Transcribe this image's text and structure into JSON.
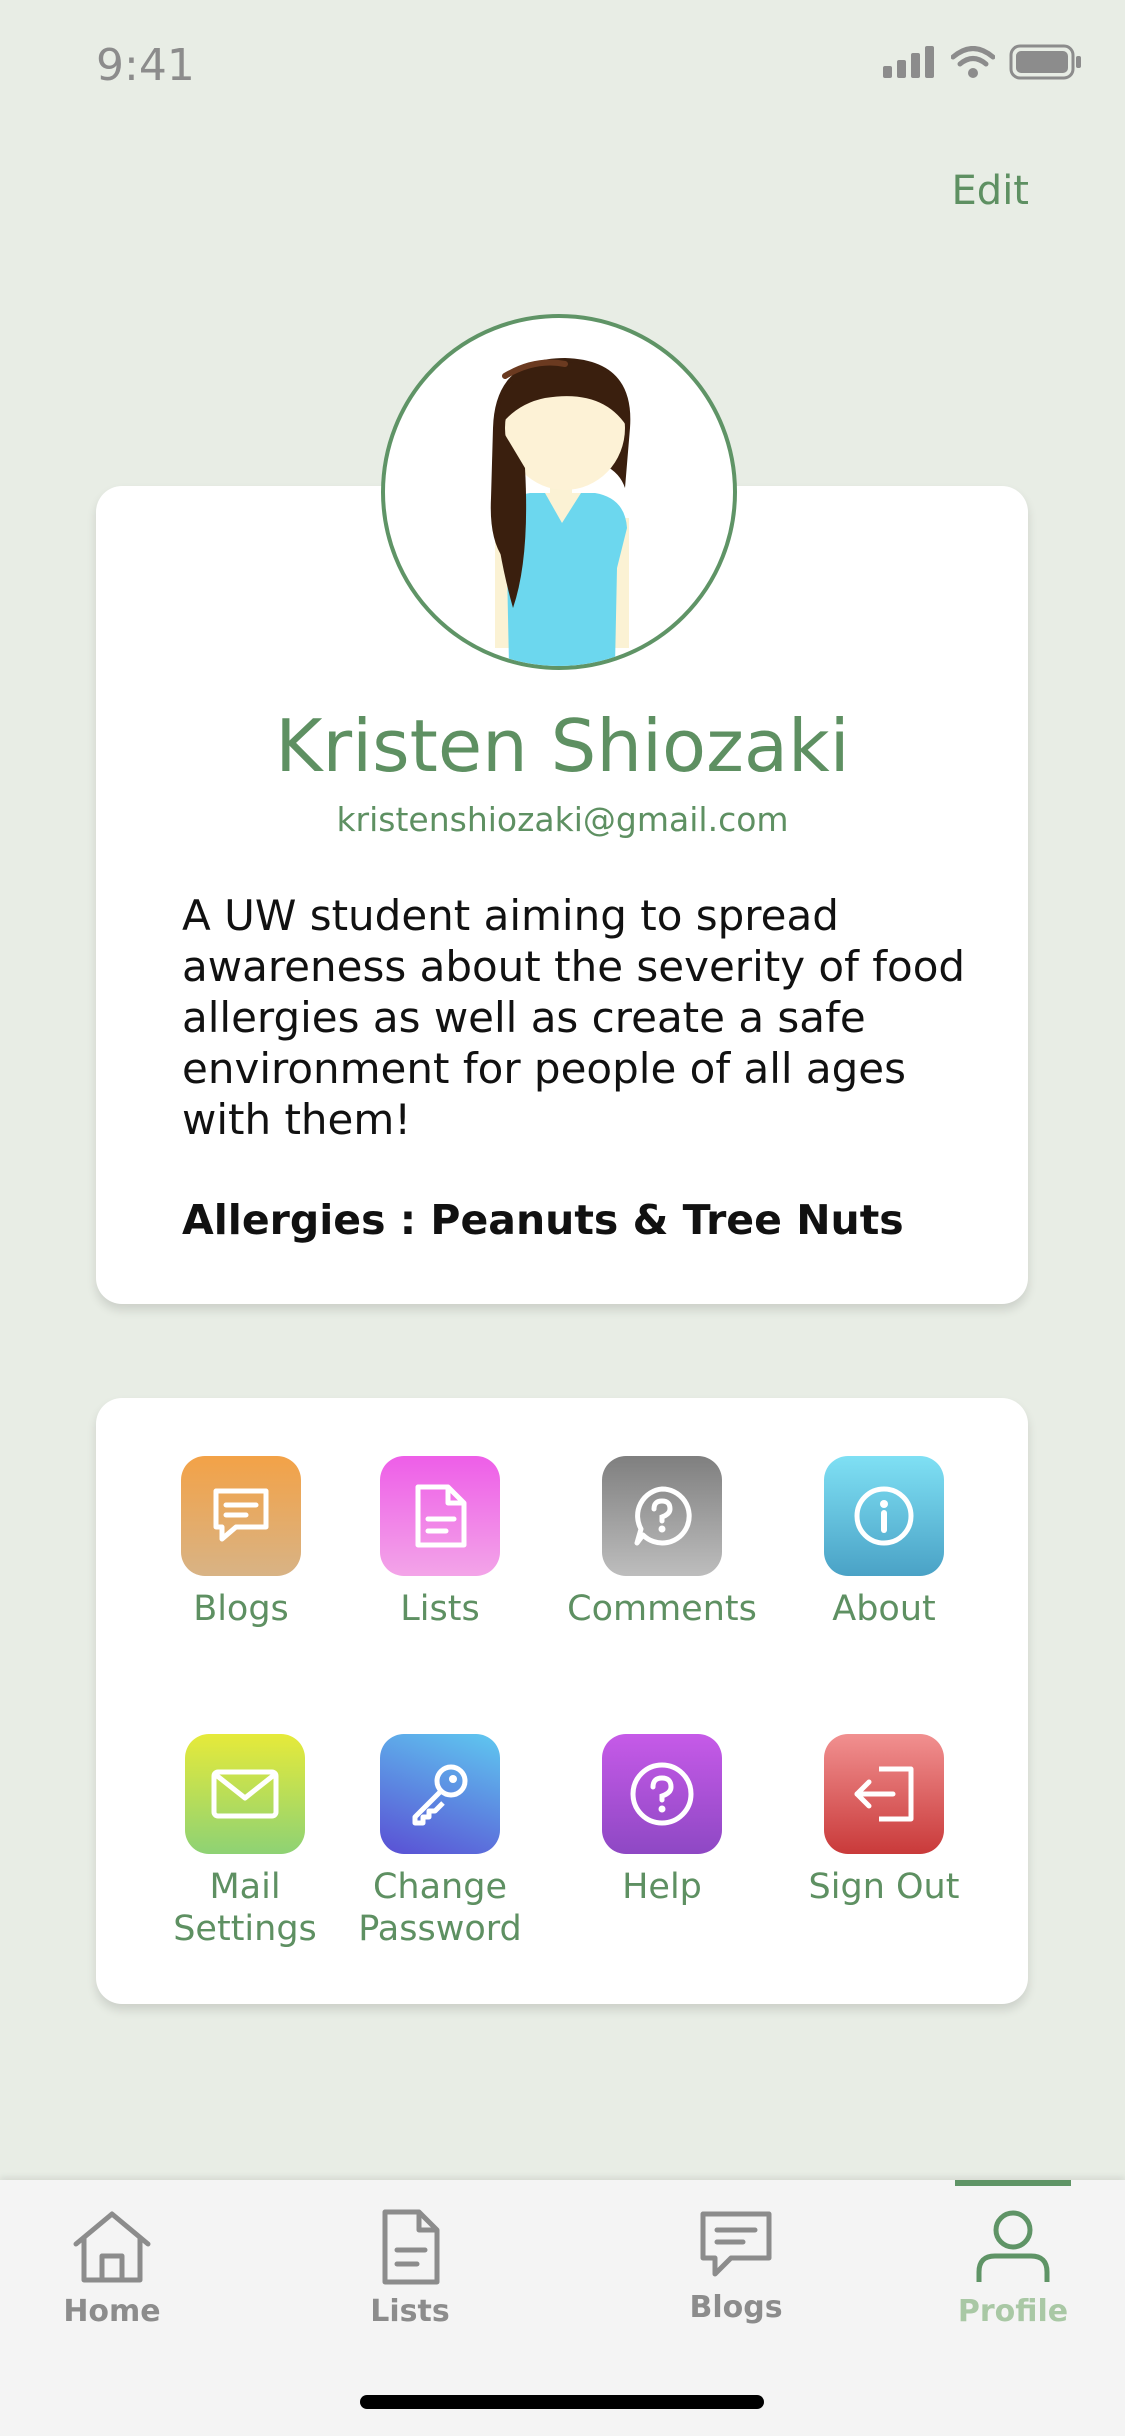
{
  "status_bar": {
    "time": "9:41"
  },
  "header": {
    "edit_label": "Edit"
  },
  "profile": {
    "name": "Kristen Shiozaki",
    "email": "kristenshiozaki@gmail.com",
    "bio": "A UW student aiming to spread awareness about the severity of food allergies as well as create a safe environment for people of all ages with them!",
    "allergies": "Allergies : Peanuts & Tree Nuts"
  },
  "menu": {
    "items": [
      {
        "label": "Blogs",
        "icon": "chat-bubble-icon",
        "color": "#dea063"
      },
      {
        "label": "Lists",
        "icon": "document-icon",
        "color": "#ee74e6"
      },
      {
        "label": "Comments",
        "icon": "question-bubble-icon",
        "color": "#9b9b9b"
      },
      {
        "label": "About",
        "icon": "info-icon",
        "color": "#5cc0dd"
      },
      {
        "label": "Mail Settings",
        "icon": "mail-icon",
        "color": "#b4d84a"
      },
      {
        "label": "Change Password",
        "icon": "key-icon",
        "color": "#5a7fe0"
      },
      {
        "label": "Help",
        "icon": "help-icon",
        "color": "#a54fd6"
      },
      {
        "label": "Sign Out",
        "icon": "sign-out-icon",
        "color": "#e06464"
      }
    ]
  },
  "tabbar": {
    "tabs": [
      {
        "label": "Home",
        "icon": "home-icon"
      },
      {
        "label": "Lists",
        "icon": "document-icon"
      },
      {
        "label": "Blogs",
        "icon": "chat-bubble-icon"
      },
      {
        "label": "Profile",
        "icon": "person-icon"
      }
    ],
    "active": "Profile"
  },
  "colors": {
    "accent": "#5e9062",
    "background": "#e8ede5"
  }
}
